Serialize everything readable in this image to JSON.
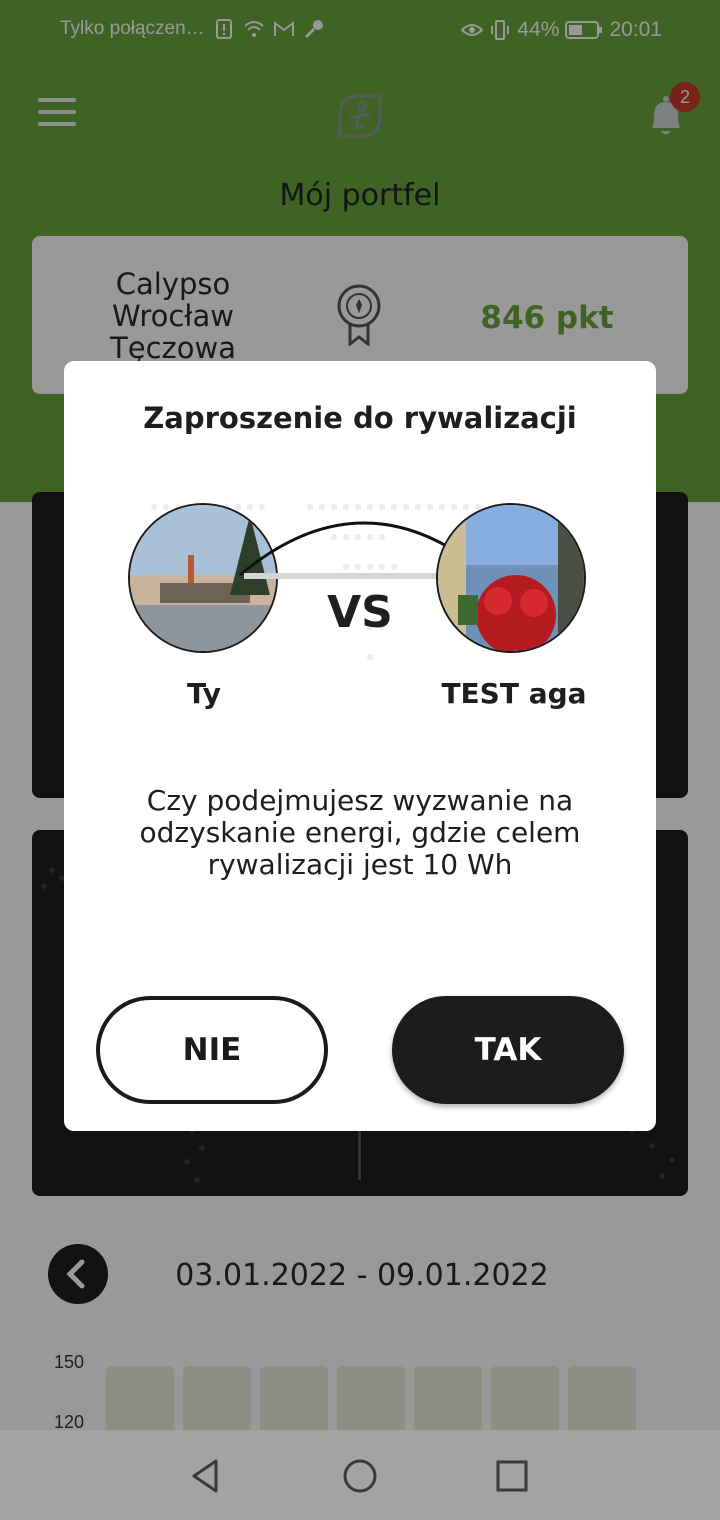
{
  "status_bar": {
    "carrier_text": "Tylko połączen…",
    "battery_percent": "44%",
    "time": "20:01",
    "icons": [
      "alert-icon",
      "wifi-icon",
      "gmail-icon",
      "wrench-icon",
      "eye-icon",
      "vibrate-icon",
      "battery-icon"
    ]
  },
  "header": {
    "title": "Mój portfel",
    "notification_count": "2"
  },
  "wallet": {
    "name": "Calypso Wrocław Tęczowa",
    "points": "846 pkt"
  },
  "dialog": {
    "title": "Zaproszenie do rywalizacji",
    "vs_label": "VS",
    "left_player": "Ty",
    "right_player": "TEST aga",
    "message": "Czy podejmujesz wyzwanie na odzyskanie energi, gdzie celem rywalizacji jest 10 Wh",
    "no_label": "NIE",
    "yes_label": "TAK"
  },
  "week": {
    "range": "03.01.2022 - 09.01.2022",
    "y_labels": [
      "150",
      "120"
    ]
  },
  "colors": {
    "brand_green": "#6aa63d",
    "notification_red": "#c83a2c",
    "dark_card": "#1d1d1f"
  }
}
